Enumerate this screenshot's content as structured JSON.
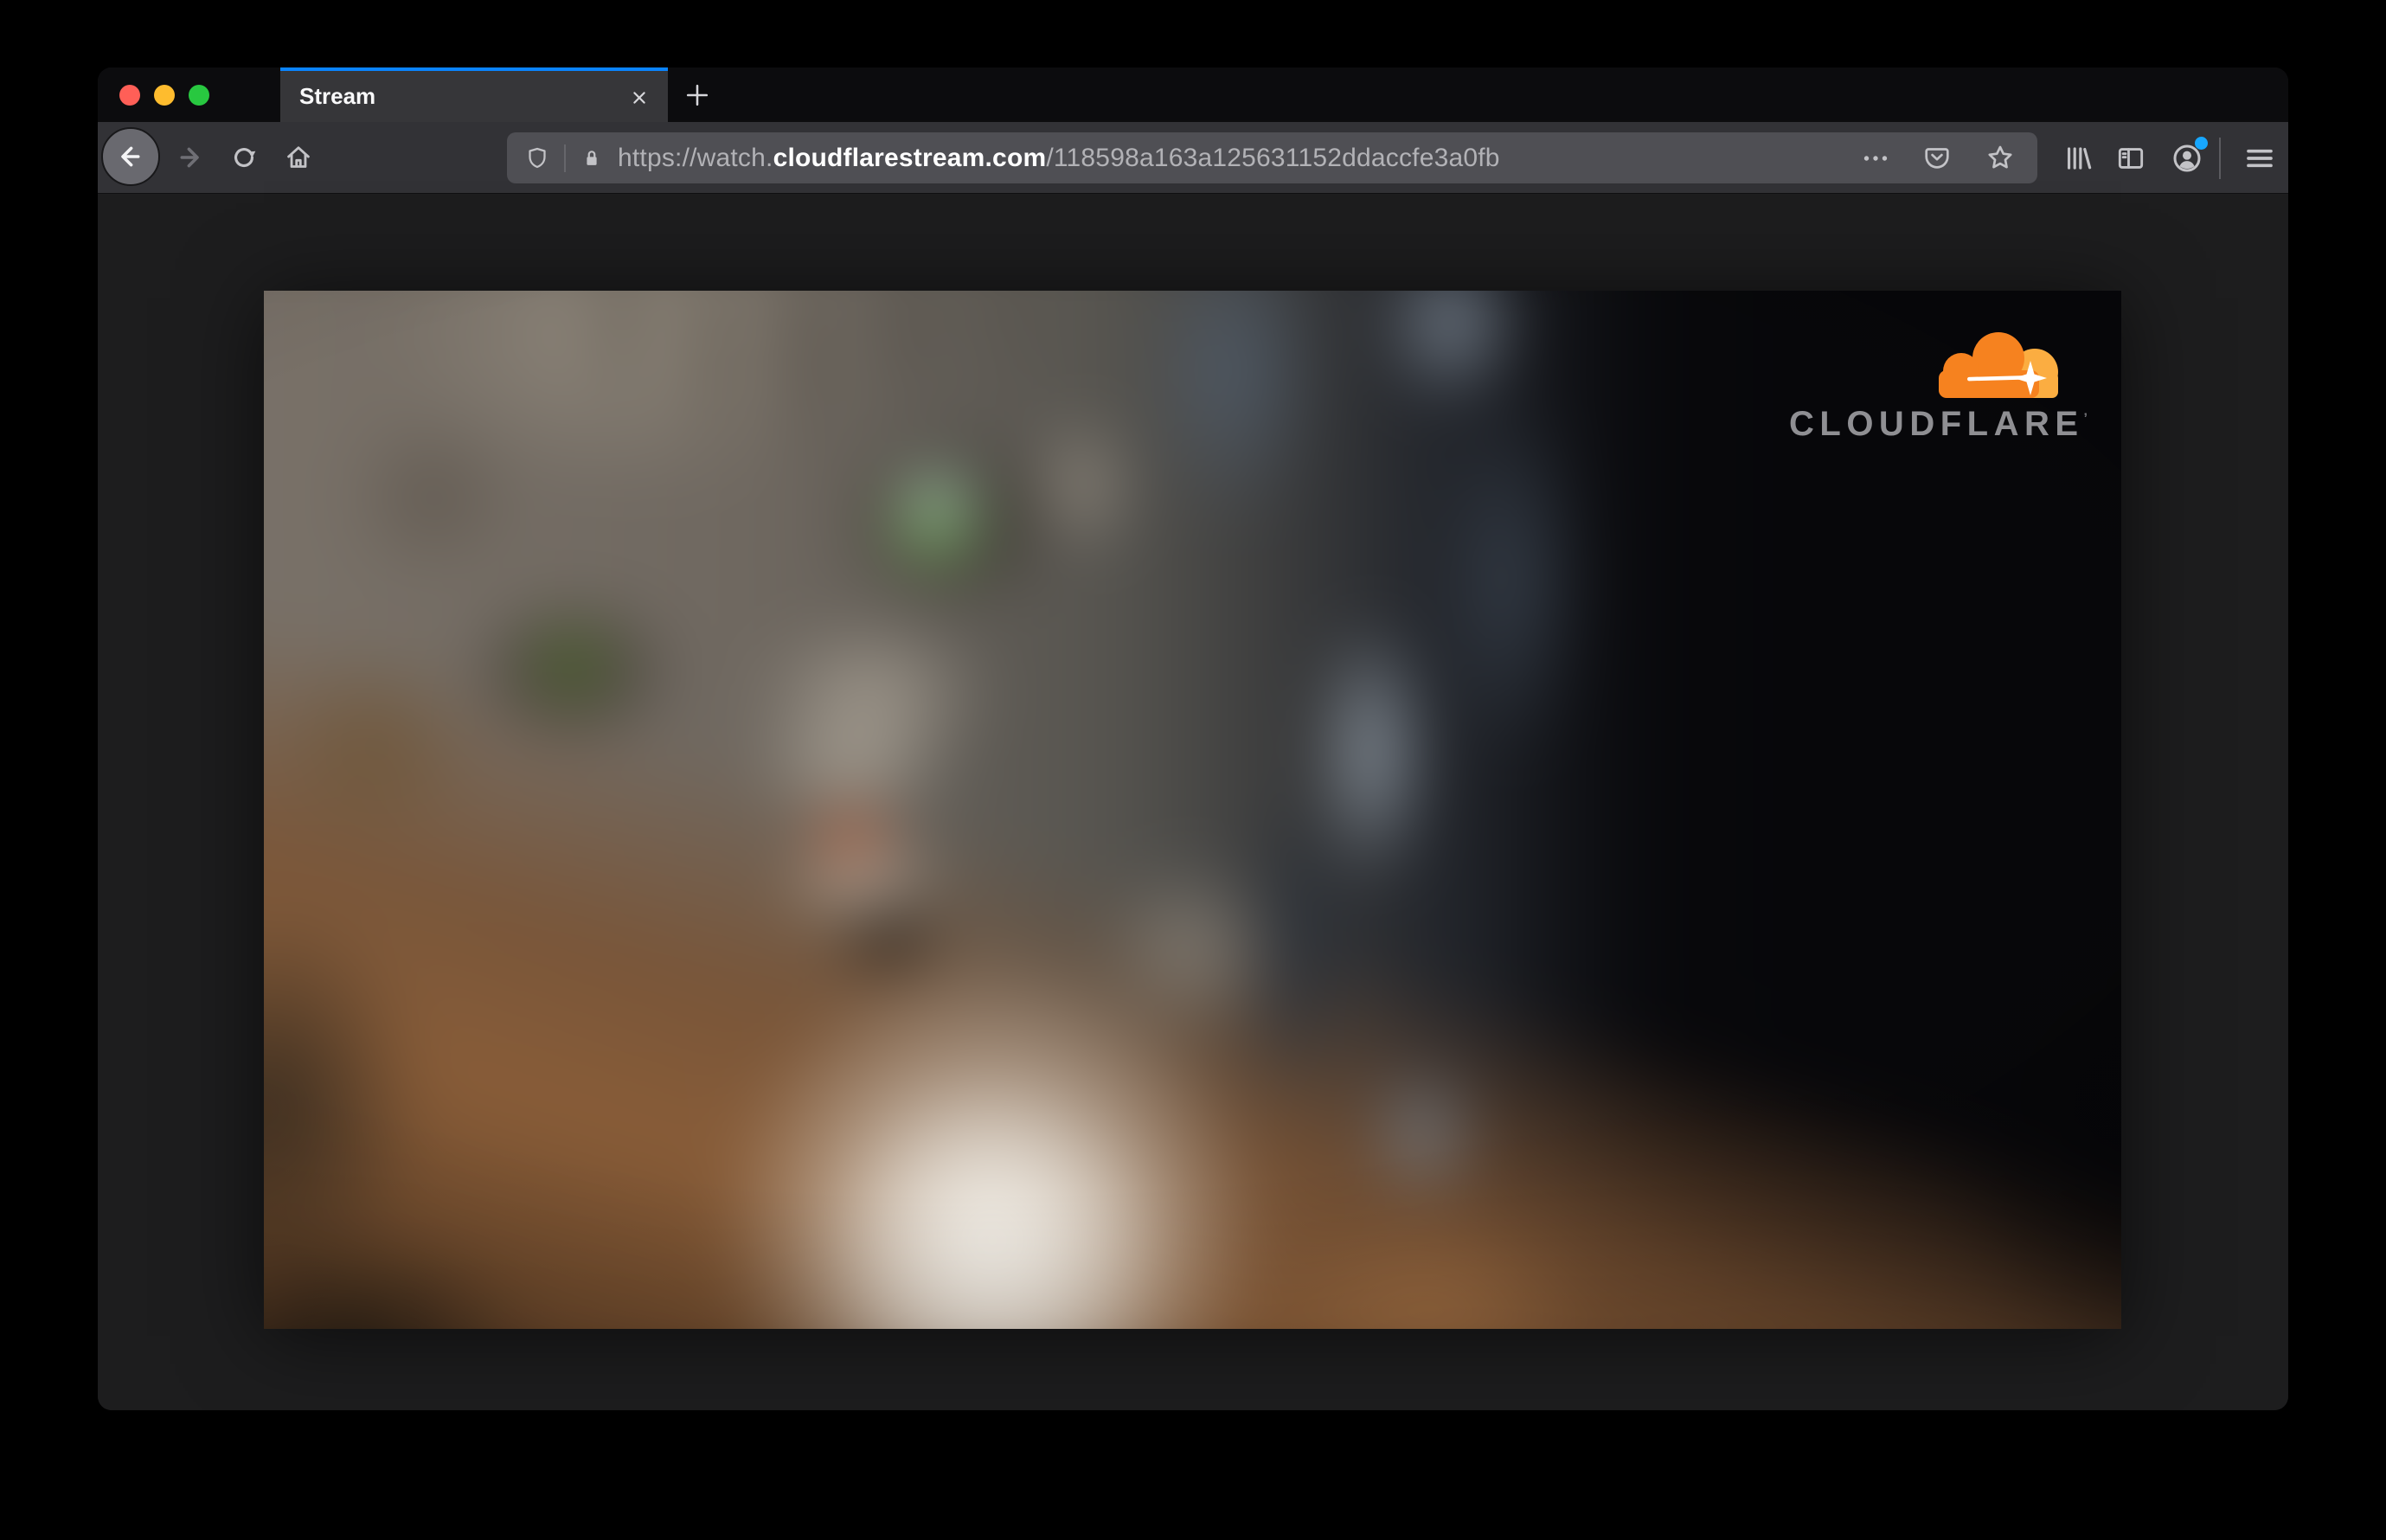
{
  "browser": {
    "window_controls": {
      "close_color": "#ff5f57",
      "minimize_color": "#febc2e",
      "zoom_color": "#28c840"
    },
    "tab": {
      "title": "Stream",
      "accent_color": "#0a84ff"
    },
    "url_bar": {
      "scheme_subdomain": "https://watch.",
      "domain": "cloudflarestream.com",
      "path": "/118598a163a125631152ddaccfe3a0fb"
    },
    "account_notification_color": "#17a7ff"
  },
  "video": {
    "brand_wordmark": "CLOUDFLARE",
    "trademark_mark": "’",
    "cloud_orange": "#f6821f",
    "cloud_light_orange": "#fbad41"
  },
  "icons": {
    "traffic-close-icon": "red circle",
    "traffic-minimize-icon": "yellow circle",
    "traffic-zoom-icon": "green circle",
    "close-tab-icon": "x",
    "new-tab-icon": "plus",
    "back-icon": "left arrow",
    "forward-icon": "right arrow",
    "refresh-icon": "circular arrow",
    "home-icon": "house",
    "shield-icon": "tracking protection shield",
    "lock-icon": "padlock",
    "page-actions-icon": "ellipsis dots",
    "pocket-icon": "pocket badge with chevron",
    "bookmark-star-icon": "star outline",
    "library-icon": "book spines",
    "sidebar-icon": "split panel",
    "account-icon": "person in circle",
    "menu-icon": "hamburger bars",
    "cloudflare-cloud-icon": "orange cloud with sparkle"
  }
}
